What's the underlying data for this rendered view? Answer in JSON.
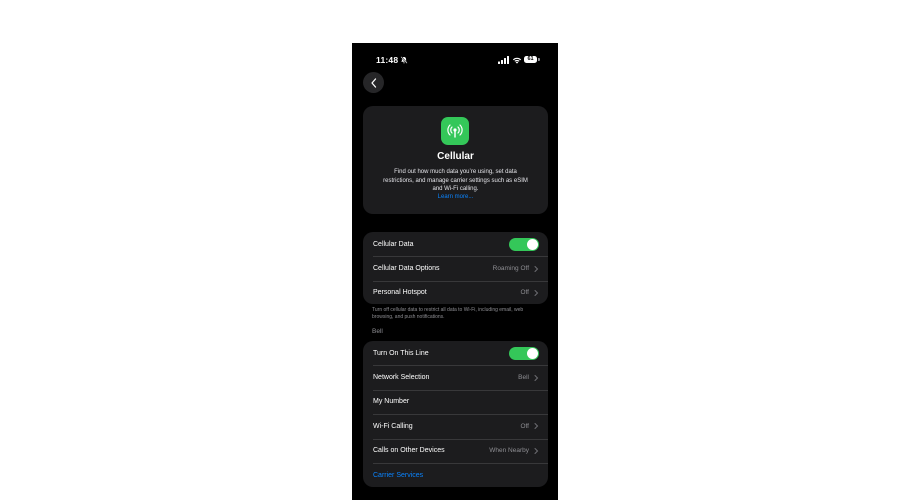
{
  "status_bar": {
    "time": "11:48",
    "battery_level": "61",
    "icons": [
      "bell-slash-icon",
      "signal-icon",
      "wifi-icon",
      "battery-icon"
    ]
  },
  "nav": {
    "back_icon": "chevron-left-icon"
  },
  "hero": {
    "icon": "antenna-icon",
    "icon_color": "#34c759",
    "title": "Cellular",
    "description": "Find out how much data you’re using, set data restrictions, and manage carrier settings such as eSIM and Wi-Fi calling.",
    "link": "Learn more..."
  },
  "group1": {
    "rows": [
      {
        "label": "Cellular Data",
        "toggle": true
      },
      {
        "label": "Cellular Data Options",
        "value": "Roaming Off"
      },
      {
        "label": "Personal Hotspot",
        "value": "Off"
      }
    ],
    "footer": "Turn off cellular data to restrict all data to Wi-Fi, including email, web browsing, and push notifications."
  },
  "group2": {
    "header": "Bell",
    "rows": [
      {
        "label": "Turn On This Line",
        "toggle": true
      },
      {
        "label": "Network Selection",
        "value": "Bell"
      },
      {
        "label": "My Number"
      },
      {
        "label": "Wi-Fi Calling",
        "value": "Off"
      },
      {
        "label": "Calls on Other Devices",
        "value": "When Nearby"
      },
      {
        "label": "Carrier Services"
      }
    ]
  },
  "colors": {
    "accent": "#0a84ff",
    "toggle_on": "#34c759",
    "card_bg": "#1c1c1e",
    "background": "#000000"
  }
}
